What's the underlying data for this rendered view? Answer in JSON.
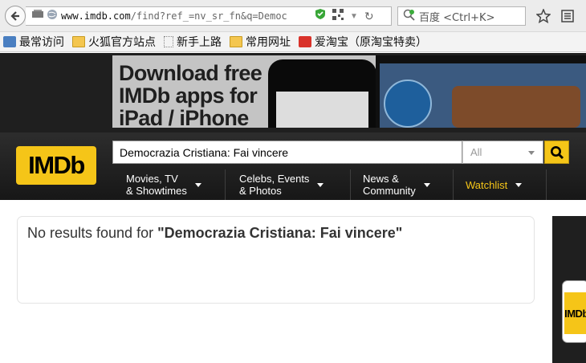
{
  "browser": {
    "url_host": "www.imdb.com",
    "url_rest": "/find?ref_=nv_sr_fn&q=Democ",
    "search_placeholder": "百度 <Ctrl+K>"
  },
  "bookmarks": [
    {
      "label": "最常访问",
      "icon": "globe-icon"
    },
    {
      "label": "火狐官方站点",
      "icon": "folder-icon"
    },
    {
      "label": "新手上路",
      "icon": "page-icon"
    },
    {
      "label": "常用网址",
      "icon": "folder-icon"
    },
    {
      "label": "爱淘宝（原淘宝特卖）",
      "icon": "taobao-icon"
    }
  ],
  "banner": {
    "line1": "Download free",
    "line2": "IMDb apps for",
    "line3": "iPad / iPhone"
  },
  "imdb": {
    "logo": "IMDb",
    "search_value": "Democrazia Cristiana: Fai vincere",
    "search_category": "All"
  },
  "nav": [
    {
      "label": "Movies, TV\n& Showtimes"
    },
    {
      "label": "Celebs, Events\n& Photos"
    },
    {
      "label": "News &\nCommunity"
    },
    {
      "label": "Watchlist"
    }
  ],
  "results": {
    "prefix": "No results found for ",
    "query": "\"Democrazia Cristiana: Fai vincere\""
  },
  "side_ad": {
    "logo": "IMDb"
  },
  "colors": {
    "imdb_yellow": "#f5c518",
    "header_dark": "#1f1f1f"
  }
}
